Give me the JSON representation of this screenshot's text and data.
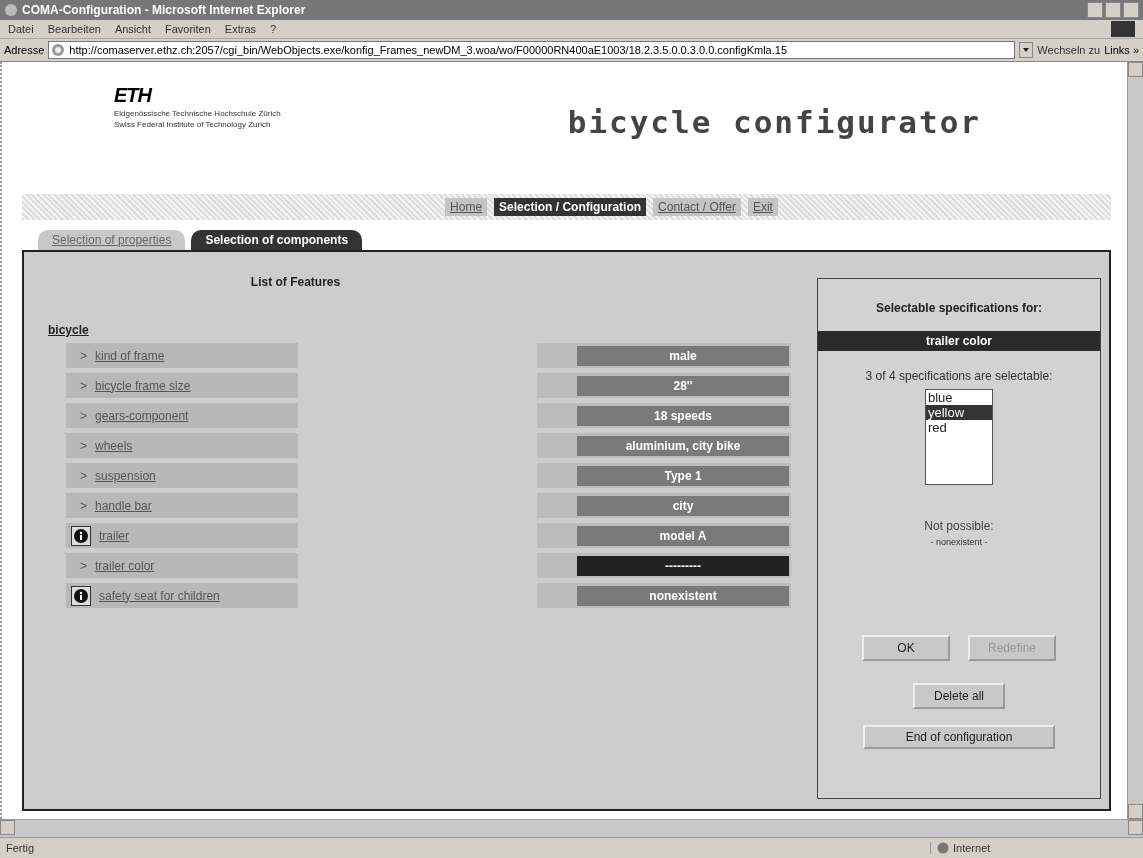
{
  "window": {
    "title": "COMA-Configuration - Microsoft Internet Explorer"
  },
  "menu": [
    "Datei",
    "Bearbeiten",
    "Ansicht",
    "Favoriten",
    "Extras",
    "?"
  ],
  "address_bar": {
    "label": "Adresse",
    "url": "http://comaserver.ethz.ch:2057/cgi_bin/WebObjects.exe/konfig_Frames_newDM_3.woa/wo/F00000RN400aE1003/18.2.3.5.0.0.3.0.0.configKmla.15",
    "go_button": "Wechseln zu",
    "links": "Links »"
  },
  "header": {
    "logo": "ETH",
    "logo_subtitle": [
      "Eidgenössische Technische Hochschule Zürich",
      "Swiss Federal Institute of Technology Zurich"
    ],
    "title": "bicycle configurator"
  },
  "nav": [
    {
      "label": "Home",
      "selected": false
    },
    {
      "label": "Selection / Configuration",
      "selected": true
    },
    {
      "label": "Contact / Offer",
      "selected": false
    },
    {
      "label": "Exit",
      "selected": false
    }
  ],
  "tabs": [
    {
      "label": "Selection of properties",
      "selected": false
    },
    {
      "label": "Selection of components",
      "selected": true
    }
  ],
  "features": {
    "title": "List of Features",
    "root": "bicycle",
    "rows": [
      {
        "kind": "arrow",
        "marker": ">",
        "name": "kind of frame",
        "value": "male",
        "selected": false
      },
      {
        "kind": "arrow",
        "marker": ">",
        "name": "bicycle frame size",
        "value": "28''",
        "selected": false
      },
      {
        "kind": "arrow",
        "marker": ">",
        "name": "gears-component",
        "value": "18 speeds",
        "selected": false
      },
      {
        "kind": "arrow",
        "marker": ">",
        "name": "wheels",
        "value": "aluminium, city bike",
        "selected": false
      },
      {
        "kind": "arrow",
        "marker": ">",
        "name": "suspension",
        "value": "Type 1",
        "selected": false
      },
      {
        "kind": "arrow",
        "marker": ">",
        "name": "handle bar",
        "value": "city",
        "selected": false
      },
      {
        "kind": "info",
        "name": "trailer",
        "value": "model A",
        "selected": false
      },
      {
        "kind": "arrow",
        "marker": ">",
        "name": "trailer color",
        "value": "---------",
        "selected": true
      },
      {
        "kind": "info",
        "name": "safety seat for children",
        "value": "nonexistent",
        "selected": false
      }
    ]
  },
  "spec_panel": {
    "title": "Selectable specifications for:",
    "feature": "trailer color",
    "summary": "3 of 4 specifications are selectable:",
    "options": [
      {
        "label": "blue",
        "selected": false
      },
      {
        "label": "yellow",
        "selected": true
      },
      {
        "label": "red",
        "selected": false
      }
    ],
    "not_possible_label": "Not possible:",
    "not_possible": "- nonexistent -",
    "buttons": [
      {
        "label": "OK",
        "disabled": false
      },
      {
        "label": "Redefine",
        "disabled": true
      }
    ],
    "actions": [
      "Delete all",
      "End of configuration"
    ]
  },
  "status_bar": {
    "text": "Fertig",
    "zone": "Internet"
  }
}
